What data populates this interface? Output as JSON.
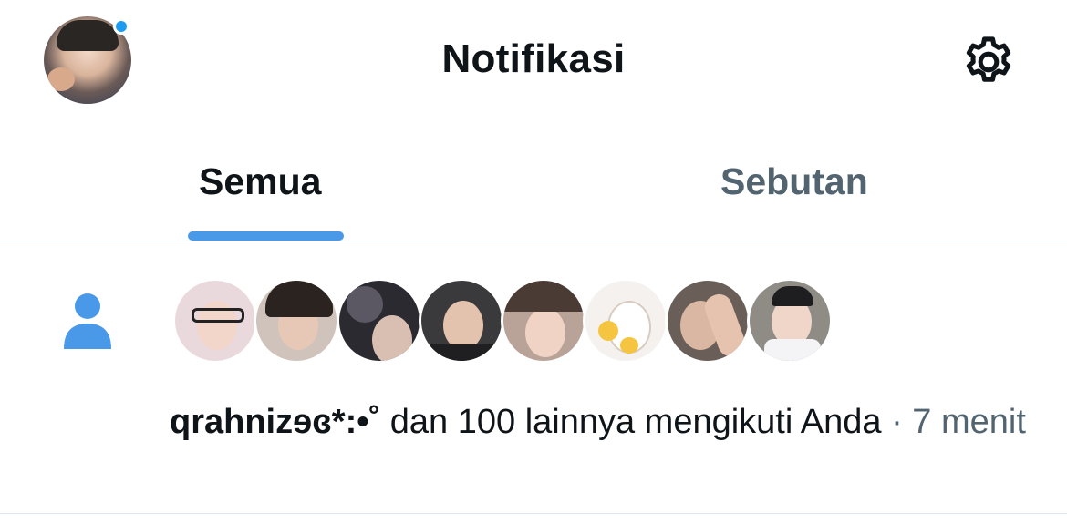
{
  "header": {
    "title": "Notifikasi",
    "avatar_icon": "profile-avatar",
    "notification_dot_color": "#1d9bf0",
    "settings_icon": "gear-icon"
  },
  "tabs": [
    {
      "label": "Semua",
      "active": true
    },
    {
      "label": "Sebutan",
      "active": false
    }
  ],
  "accent_color": "#4a99e9",
  "notification": {
    "type_icon": "person-icon",
    "follower_count_shown": 8,
    "username": "qrahnizɘɞ*:•˚",
    "message": " dan 100 lainnya mengikuti Anda",
    "separator": " · ",
    "time": "7 menit"
  }
}
